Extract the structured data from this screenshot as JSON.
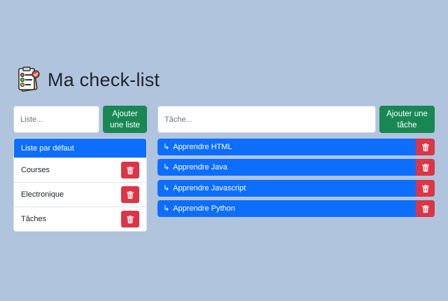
{
  "header": {
    "title": "Ma check-list",
    "icon": "checklist-clipboard-icon"
  },
  "lists": {
    "input_placeholder": "Liste...",
    "add_button": "Ajouter une liste",
    "items": [
      {
        "label": "Liste par défaut",
        "active": true
      },
      {
        "label": "Courses",
        "active": false
      },
      {
        "label": "Electronique",
        "active": false
      },
      {
        "label": "Tâches",
        "active": false
      }
    ]
  },
  "tasks": {
    "input_placeholder": "Tâche...",
    "add_button": "Ajouter une tâche",
    "items": [
      {
        "label": "Apprendre HTML"
      },
      {
        "label": "Apprendre Java"
      },
      {
        "label": "Apprendre Javascript"
      },
      {
        "label": "Apprendre Python"
      }
    ]
  },
  "colors": {
    "background": "#b0c4de",
    "primary": "#0d6efd",
    "success": "#198754",
    "danger": "#dc3545"
  }
}
